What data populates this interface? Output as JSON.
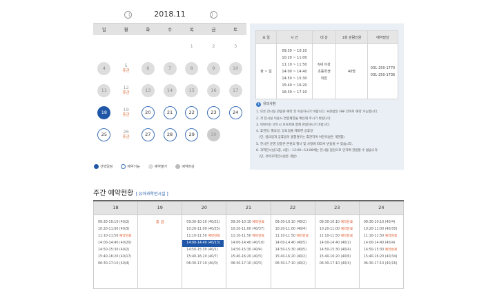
{
  "calendar": {
    "month": "2018.11",
    "prev_icon": "〈",
    "next_icon": "〉",
    "weekdays": [
      "일",
      "월",
      "화",
      "수",
      "목",
      "금",
      "토"
    ],
    "weeks": [
      [
        {
          "d": "",
          "t": "empty"
        },
        {
          "d": "",
          "t": "empty"
        },
        {
          "d": "",
          "t": "empty"
        },
        {
          "d": "",
          "t": "empty"
        },
        {
          "d": "1",
          "t": "plain"
        },
        {
          "d": "2",
          "t": "plain"
        },
        {
          "d": "3",
          "t": "plain"
        }
      ],
      [
        {
          "d": "4",
          "t": "gray"
        },
        {
          "d": "5",
          "t": "closed",
          "note": "휴관"
        },
        {
          "d": "6",
          "t": "gray"
        },
        {
          "d": "7",
          "t": "gray"
        },
        {
          "d": "8",
          "t": "gray"
        },
        {
          "d": "9",
          "t": "gray"
        },
        {
          "d": "10",
          "t": "gray"
        }
      ],
      [
        {
          "d": "11",
          "t": "gray"
        },
        {
          "d": "12",
          "t": "closed",
          "note": "휴관"
        },
        {
          "d": "13",
          "t": "gray"
        },
        {
          "d": "14",
          "t": "gray"
        },
        {
          "d": "15",
          "t": "gray"
        },
        {
          "d": "16",
          "t": "gray"
        },
        {
          "d": "17",
          "t": "gray"
        }
      ],
      [
        {
          "d": "18",
          "t": "sel"
        },
        {
          "d": "19",
          "t": "closed",
          "note": "휴관"
        },
        {
          "d": "20",
          "t": "avail"
        },
        {
          "d": "21",
          "t": "avail"
        },
        {
          "d": "22",
          "t": "avail"
        },
        {
          "d": "23",
          "t": "avail"
        },
        {
          "d": "24",
          "t": "avail"
        }
      ],
      [
        {
          "d": "25",
          "t": "avail"
        },
        {
          "d": "26",
          "t": "closed",
          "note": "휴관"
        },
        {
          "d": "27",
          "t": "avail"
        },
        {
          "d": "28",
          "t": "avail"
        },
        {
          "d": "29",
          "t": "avail"
        },
        {
          "d": "30",
          "t": "dis"
        },
        {
          "d": "",
          "t": "empty"
        }
      ]
    ],
    "legend": [
      "선택일정",
      "예약가능",
      "예약불가",
      "예약마감"
    ]
  },
  "info_table": {
    "headers": [
      "요 일",
      "시 간",
      "대 상",
      "1회 관람인원",
      "예약담당"
    ],
    "day": "화 ~ 일",
    "times": [
      "09:30 ~ 10:10",
      "10:20 ~ 11:00",
      "11:10 ~ 11:50",
      "14:00 ~ 14:40",
      "14:50 ~ 15:30",
      "15:40 ~ 16:20",
      "16:30 ~ 17:10"
    ],
    "target": [
      "6세 이상",
      "초등학생",
      "미만"
    ],
    "capacity": "40명",
    "contacts": [
      "031-250-1770",
      "031-250-1736"
    ]
  },
  "notes": {
    "title": "유의사항",
    "items": [
      "1. 모든 전시실 관람은 예약 후 이용하시기 바랍니다. ※관람일 하루 전까지 예약 가능합니다.",
      "2. 각 전시실 이용시 연령제한을 확인해 주시기 바랍니다.",
      "3. 어린이는 반드시 보호자와 함께 관람하시기 바랍니다.",
      "4. 휴관일: 월요일, 일요일을 제외한 공휴일",
      "   (단, 일요일과 공휴일이 겹칠경우는 휴관하며 어린이날은 개관함)",
      "5. 전시관 운영 일정은 본원의 행사 및 사정에 따라서 변동될 수 있습니다.",
      "6. 과학전시실(1층, 4층) : 12:00~13:00에는 전시물 점검으로 인하여 관람할 수 없습니다.",
      "   (단, 유아과학전시실은 개방)"
    ]
  },
  "weekly": {
    "title": "주간 예약현황",
    "subtitle": "[ 유아과학전시실 ]",
    "days": [
      {
        "h": "18",
        "slots": [
          [
            "09:30-10:10 (40/2)",
            ""
          ],
          [
            "10:20-11:00 (40/3)",
            ""
          ],
          [
            "11:10-11:50 ",
            "예약완료"
          ],
          [
            "14:00-14:40 (40/20)",
            ""
          ],
          [
            "14:50-15:30 (40/2)",
            ""
          ],
          [
            "15:40-16:20 (40/17)",
            ""
          ],
          [
            "06:30-17:10 (40/4)",
            ""
          ]
        ]
      },
      {
        "h": "19",
        "closed": "휴 관",
        "slots": []
      },
      {
        "h": "20",
        "slots": [
          [
            "09:30-10:10 (40/21)",
            ""
          ],
          [
            "10:20-11:00 (40/25)",
            ""
          ],
          [
            "11:10-11:50 ",
            "예약완료"
          ],
          [
            "14:00-14:40 (40/13)",
            "",
            "sel"
          ],
          [
            "14:50-15:30 (40/1)",
            ""
          ],
          [
            "15:40-16:20 (40/7)",
            ""
          ],
          [
            "06:30-17:10 (40/0)",
            ""
          ]
        ]
      },
      {
        "h": "21",
        "slots": [
          [
            "09:30-10:10 ",
            "예약완료"
          ],
          [
            "10:20-11:00 (40/37)",
            ""
          ],
          [
            "11:10-11:50 ",
            "예약완료"
          ],
          [
            "14:00-14:40 (40/10)",
            ""
          ],
          [
            "14:50-15:30 (40/4)",
            ""
          ],
          [
            "15:40-16:20 (40/3)",
            ""
          ],
          [
            "06:30-17:10 (40/3)",
            ""
          ]
        ]
      },
      {
        "h": "22",
        "slots": [
          [
            "09:30-10:10 (40/2)",
            ""
          ],
          [
            "10:20-11:00 (40/4)",
            ""
          ],
          [
            "11:10-11:50 ",
            "예약완료"
          ],
          [
            "14:00-14:40 (40/5)",
            ""
          ],
          [
            "14:50-15:30 (40/5)",
            ""
          ],
          [
            "15:40-16:20 (40/2)",
            ""
          ],
          [
            "06:30-17:10 (40/2)",
            ""
          ]
        ]
      },
      {
        "h": "23",
        "slots": [
          [
            "09:30-10:10 ",
            "예약완료"
          ],
          [
            "10:20-11:00 ",
            "예약완료"
          ],
          [
            "11:10-11:50 ",
            "예약완료"
          ],
          [
            "14:00-14:40 (40/2)",
            ""
          ],
          [
            "14:50-15:30 (40/4)",
            ""
          ],
          [
            "15:40-16:20 (40/6)",
            ""
          ],
          [
            "06:30-17:10 (40/4)",
            ""
          ]
        ]
      },
      {
        "h": "24",
        "slots": [
          [
            "09:30-10:10 (40/4)",
            ""
          ],
          [
            "10:20-11:00 (40/30)",
            ""
          ],
          [
            "11:10-11:50 ",
            "예약완료"
          ],
          [
            "14:00-14:40 (40/4)",
            ""
          ],
          [
            "14:50-15:30 ",
            "예약완료"
          ],
          [
            "15:40-16:20 (40/34)",
            ""
          ],
          [
            "06:30-17:10 (40/16)",
            ""
          ]
        ]
      }
    ]
  },
  "colors": {
    "accent": "#1f56a8",
    "reserved": "#e0582c",
    "closed": "#d86b3b"
  }
}
